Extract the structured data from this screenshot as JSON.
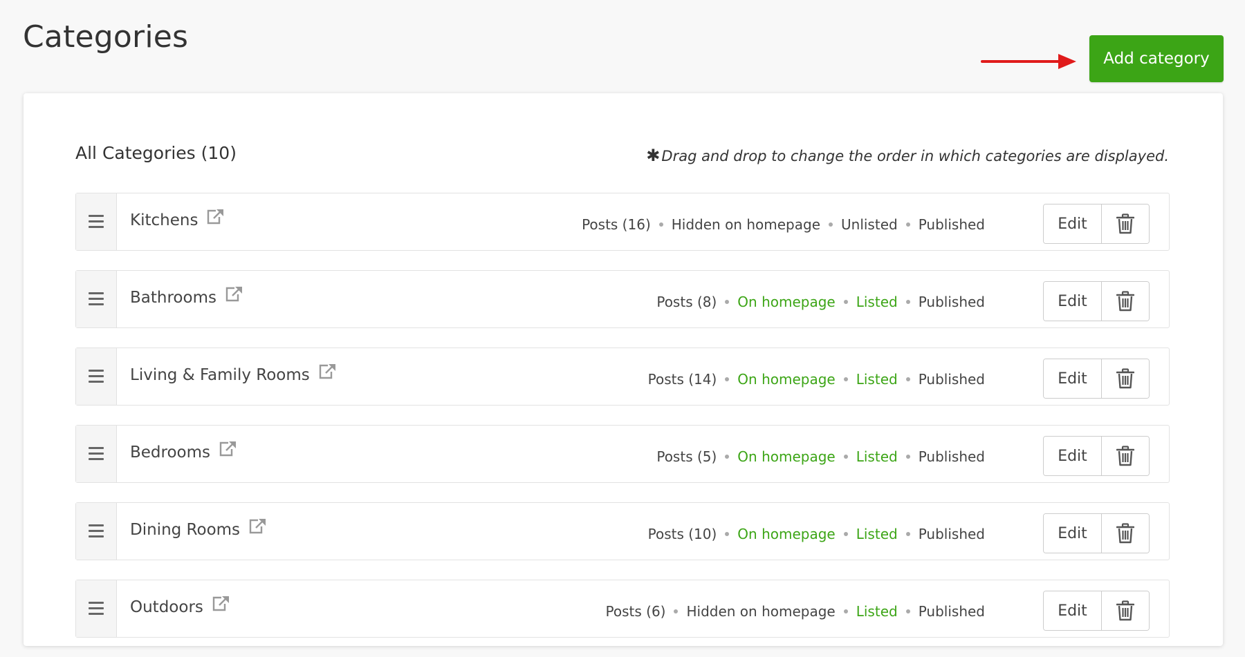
{
  "page": {
    "title": "Categories",
    "add_button_label": "Add category"
  },
  "panel": {
    "heading": "All Categories (10)",
    "note_star": "✱",
    "note": "Drag and drop to change the order in which categories are displayed."
  },
  "colors": {
    "accent_green": "#3ca516",
    "annotation_arrow": "#e01b1b"
  },
  "row_actions": {
    "edit_label": "Edit"
  },
  "categories": [
    {
      "name": "Kitchens",
      "posts": "Posts (16)",
      "homepage": "Hidden on homepage",
      "homepage_active": false,
      "listing": "Unlisted",
      "listing_active": false,
      "status": "Published"
    },
    {
      "name": "Bathrooms",
      "posts": "Posts (8)",
      "homepage": "On homepage",
      "homepage_active": true,
      "listing": "Listed",
      "listing_active": true,
      "status": "Published"
    },
    {
      "name": "Living & Family Rooms",
      "posts": "Posts (14)",
      "homepage": "On homepage",
      "homepage_active": true,
      "listing": "Listed",
      "listing_active": true,
      "status": "Published"
    },
    {
      "name": "Bedrooms",
      "posts": "Posts (5)",
      "homepage": "On homepage",
      "homepage_active": true,
      "listing": "Listed",
      "listing_active": true,
      "status": "Published"
    },
    {
      "name": "Dining Rooms",
      "posts": "Posts (10)",
      "homepage": "On homepage",
      "homepage_active": true,
      "listing": "Listed",
      "listing_active": true,
      "status": "Published"
    },
    {
      "name": "Outdoors",
      "posts": "Posts (6)",
      "homepage": "Hidden on homepage",
      "homepage_active": false,
      "listing": "Listed",
      "listing_active": true,
      "status": "Published"
    }
  ]
}
